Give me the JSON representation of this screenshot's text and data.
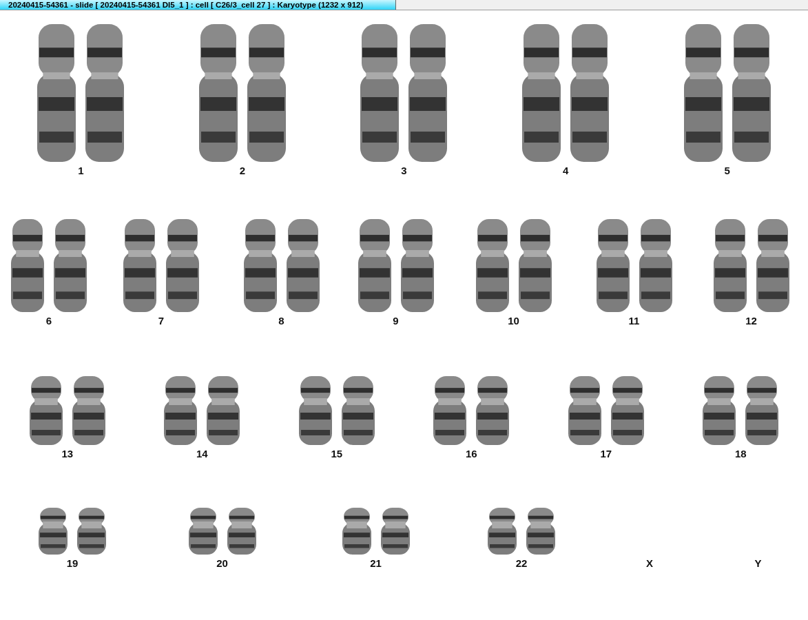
{
  "window": {
    "title": "20240415-54361 - slide [ 20240415-54361 DI5_1 ] : cell [ C26/3_cell 27 ] : Karyotype  (1232 x 912)"
  },
  "karyotype": {
    "rows": [
      {
        "groups": [
          {
            "label": "1",
            "kind": "pair"
          },
          {
            "label": "2",
            "kind": "pair"
          },
          {
            "label": "3",
            "kind": "pair"
          },
          {
            "label": "4",
            "kind": "pair"
          },
          {
            "label": "5",
            "kind": "pair"
          }
        ]
      },
      {
        "groups": [
          {
            "label": "6",
            "kind": "pair"
          },
          {
            "label": "7",
            "kind": "pair"
          },
          {
            "label": "8",
            "kind": "pair"
          },
          {
            "label": "9",
            "kind": "pair"
          },
          {
            "label": "10",
            "kind": "pair"
          },
          {
            "label": "11",
            "kind": "pair"
          },
          {
            "label": "12",
            "kind": "pair"
          }
        ]
      },
      {
        "groups": [
          {
            "label": "13",
            "kind": "pair"
          },
          {
            "label": "14",
            "kind": "pair"
          },
          {
            "label": "15",
            "kind": "pair"
          },
          {
            "label": "16",
            "kind": "pair"
          },
          {
            "label": "17",
            "kind": "pair"
          },
          {
            "label": "18",
            "kind": "pair"
          }
        ]
      },
      {
        "groups": [
          {
            "label": "19",
            "kind": "pair"
          },
          {
            "label": "20",
            "kind": "pair"
          },
          {
            "label": "21",
            "kind": "pair"
          },
          {
            "label": "22",
            "kind": "pair"
          },
          {
            "label": "X",
            "kind": "empty"
          },
          {
            "label": "Y",
            "kind": "empty"
          }
        ]
      }
    ]
  }
}
